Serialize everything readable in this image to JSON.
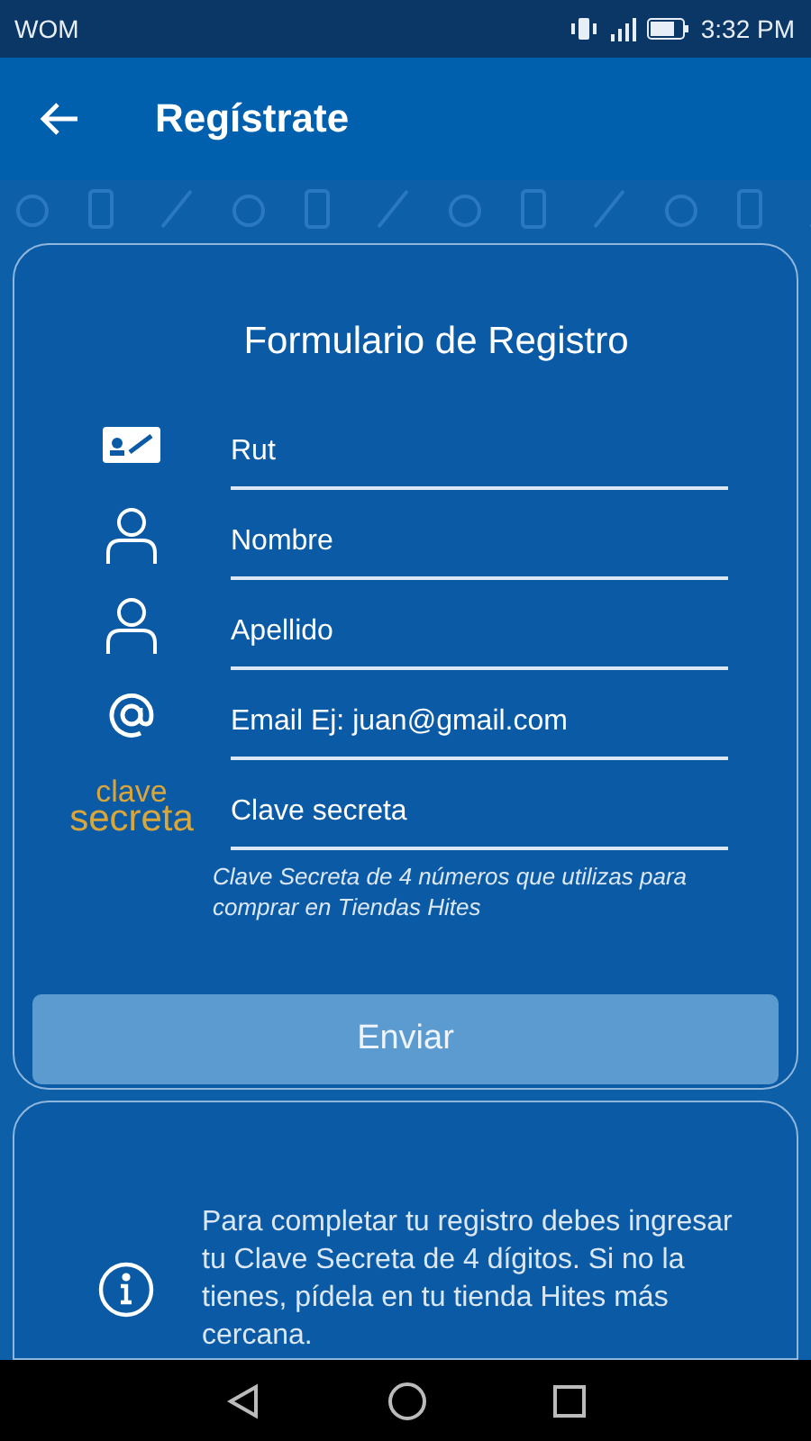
{
  "status_bar": {
    "carrier": "WOM",
    "time": "3:32 PM"
  },
  "app_bar": {
    "title": "Regístrate"
  },
  "form": {
    "title": "Formulario de Registro",
    "fields": [
      {
        "kind": "id_card",
        "placeholder": "Rut"
      },
      {
        "kind": "person",
        "placeholder": "Nombre"
      },
      {
        "kind": "person",
        "placeholder": "Apellido"
      },
      {
        "kind": "at",
        "placeholder": "Email Ej: juan@gmail.com"
      },
      {
        "kind": "logo",
        "logo_text": [
          "clave",
          "secreta"
        ],
        "placeholder": "Clave secreta"
      }
    ],
    "note": "Clave Secreta de 4 números que utilizas para comprar en Tiendas Hites",
    "button": "Enviar"
  },
  "info": {
    "text": "Para completar tu registro debes ingresar tu Clave Secreta de 4 dígitos. Si no la tienes, pídela en tu tienda Hites más cercana."
  }
}
